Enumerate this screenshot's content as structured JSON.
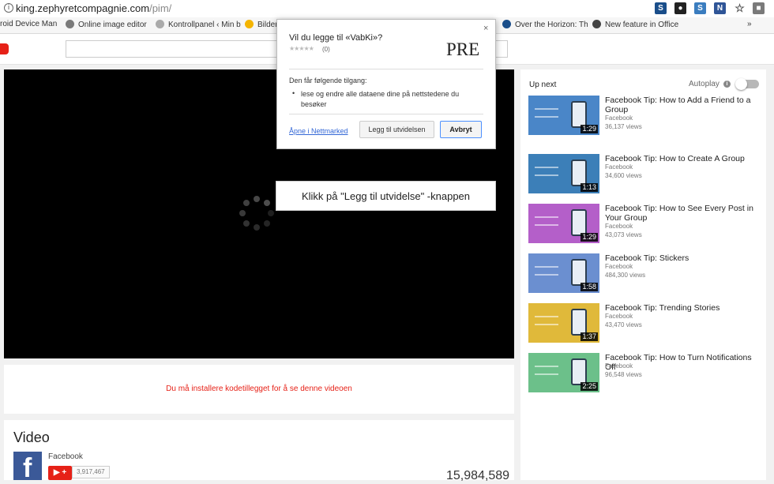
{
  "browser": {
    "url_host": "king.zephyretcompagnie.com",
    "url_path": "/pim/",
    "extensions": [
      {
        "icon": "s-extension-icon",
        "glyph": "S",
        "color": "#1a4e8a"
      },
      {
        "icon": "circle-extension-icon",
        "glyph": "●",
        "color": "#222222"
      },
      {
        "icon": "s-outline-extension-icon",
        "glyph": "S",
        "color": "#3b7dbf"
      },
      {
        "icon": "n-extension-icon",
        "glyph": "N",
        "color": "#2f5597"
      },
      {
        "icon": "star-icon",
        "glyph": "☆",
        "color": "#555555"
      },
      {
        "icon": "menu-extension-icon",
        "glyph": "■",
        "color": "#7a7a7a"
      }
    ]
  },
  "bookmarks": [
    {
      "label": "roid Device Man",
      "icon": "page-icon"
    },
    {
      "label": "Online image editor",
      "icon": "globe-icon"
    },
    {
      "label": "Kontrollpanel ‹ Min b",
      "icon": "document-icon"
    },
    {
      "label": "Bilder",
      "icon": "drive-icon"
    },
    {
      "label": "Over the Horizon: Th",
      "icon": "s-icon"
    },
    {
      "label": "New feature in Office",
      "icon": "tn-icon"
    },
    {
      "label": "»",
      "icon": "more-icon"
    }
  ],
  "plugin_message": "Du må installere kodetillegget for å se denne videoen",
  "video": {
    "title": "Video",
    "channel": "Facebook",
    "subscribe_label": "▶ +",
    "subscriber_count": "3,917,467",
    "views_partial": "15,984,589"
  },
  "sidebar": {
    "up_next": "Up next",
    "autoplay": "Autoplay",
    "items": [
      {
        "title": "Facebook Tip: How to Add a Friend to a Group",
        "channel": "Facebook",
        "views": "36,137 views",
        "duration": "1:29",
        "thumb_color": "#4a86c8",
        "title_lines": 2
      },
      {
        "title": "Facebook Tip: How to Create A Group",
        "channel": "Facebook",
        "views": "34,600 views",
        "duration": "1:13",
        "thumb_color": "#3c7fb8",
        "title_lines": 1
      },
      {
        "title": "Facebook Tip: How to See Every Post in Your Group",
        "channel": "Facebook",
        "views": "43,073 views",
        "duration": "1:29",
        "thumb_color": "#b45fc9",
        "title_lines": 2
      },
      {
        "title": "Facebook Tip: Stickers",
        "channel": "Facebook",
        "views": "484,300 views",
        "duration": "1:58",
        "thumb_color": "#6b8fd0",
        "title_lines": 1
      },
      {
        "title": "Facebook Tip: Trending Stories",
        "channel": "Facebook",
        "views": "43,470 views",
        "duration": "1:37",
        "thumb_color": "#e0b93a",
        "title_lines": 1
      },
      {
        "title": "Facebook Tip: How to Turn Notifications Off",
        "channel": "Facebook",
        "views": "96,548 views",
        "duration": "2:25",
        "thumb_color": "#6cc08a",
        "title_lines": 1
      }
    ]
  },
  "dialog": {
    "title": "Vil du legge til «VabKi»?",
    "stars": "★★★★★",
    "rating": "(0)",
    "logo": "PRE",
    "access_heading": "Den får følgende tilgang:",
    "bullet": "•",
    "permission": "lese og endre alle dataene dine på nettstedene du besøker",
    "store_link": "Åpne i Nettmarked",
    "add_button": "Legg til utvidelsen",
    "cancel_button": "Avbryt",
    "close": "×"
  },
  "callout": "Klikk på \"Legg til utvidelse\" -knappen"
}
